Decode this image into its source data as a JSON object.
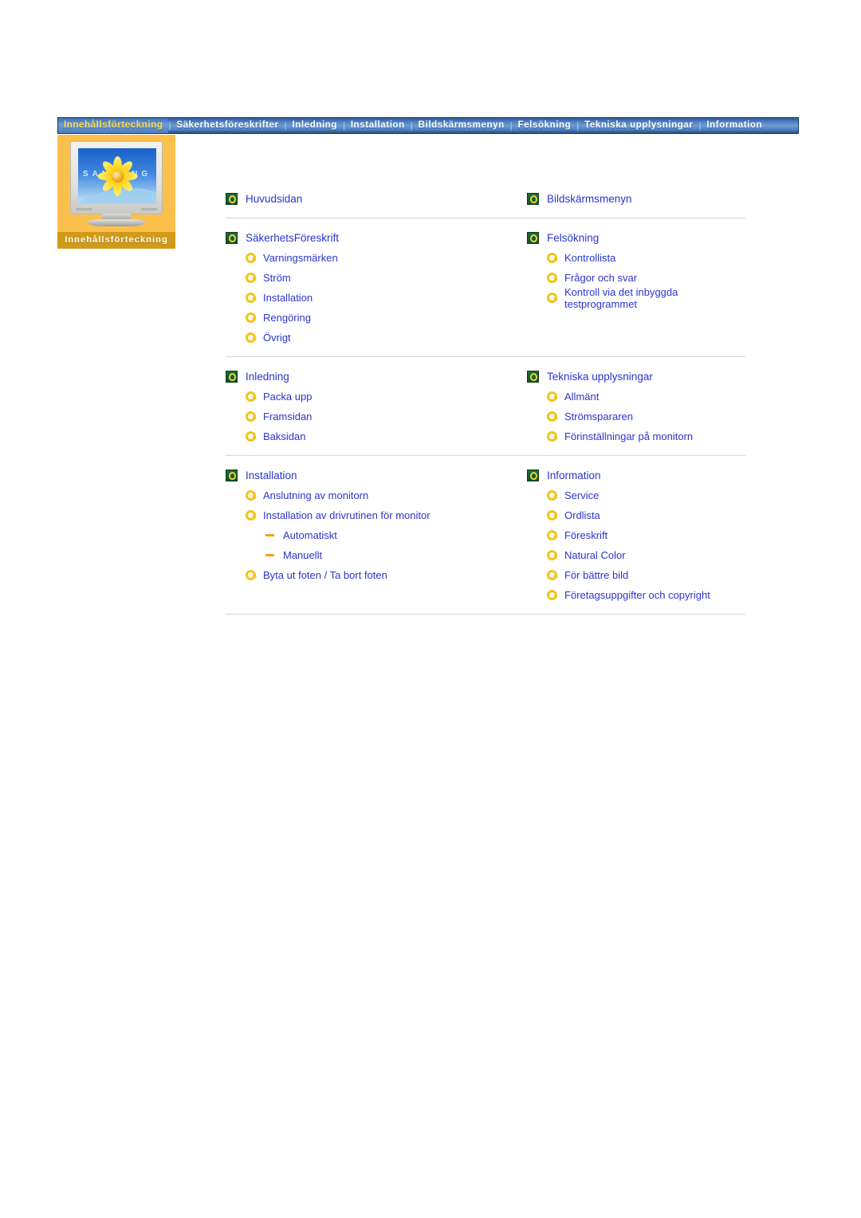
{
  "nav": {
    "items": [
      {
        "label": "Innehållsförteckning",
        "active": true
      },
      {
        "label": "Säkerhetsföreskrifter",
        "active": false
      },
      {
        "label": "Inledning",
        "active": false
      },
      {
        "label": "Installation",
        "active": false
      },
      {
        "label": "Bildskärmsmenyn",
        "active": false
      },
      {
        "label": "Felsökning",
        "active": false
      },
      {
        "label": "Tekniska upplysningar",
        "active": false
      },
      {
        "label": "Information",
        "active": false
      }
    ],
    "separator": "|"
  },
  "banner": {
    "title": "Innehållsförteckning",
    "brand_text": "SAMSUNG",
    "icon": "monitor-thumbnail"
  },
  "colors": {
    "link": "#2b35cf",
    "nav_active_text": "#ffe14d",
    "banner_bg": "#fbc14c",
    "banner_title_bg": "#d19a18",
    "divider": "#d8d8c8",
    "icon_square_green": "#14512a",
    "icon_ring_yellow": "#f2c41e",
    "icon_dash_orange": "#f0a21a"
  },
  "toc": {
    "groups": [
      {
        "left": {
          "title": "Huvudsidan",
          "children": []
        },
        "right": {
          "title": "Bildskärmsmenyn",
          "children": []
        }
      },
      {
        "left": {
          "title": "SäkerhetsFöreskrift",
          "children": [
            {
              "label": "Varningsmärken"
            },
            {
              "label": "Ström"
            },
            {
              "label": "Installation"
            },
            {
              "label": "Rengöring"
            },
            {
              "label": "Övrigt"
            }
          ]
        },
        "right": {
          "title": "Felsökning",
          "children": [
            {
              "label": "Kontrollista"
            },
            {
              "label": "Frågor och svar"
            },
            {
              "label": "Kontroll via det inbyggda testprogrammet"
            }
          ]
        }
      },
      {
        "left": {
          "title": "Inledning",
          "children": [
            {
              "label": "Packa upp"
            },
            {
              "label": "Framsidan"
            },
            {
              "label": "Baksidan"
            }
          ]
        },
        "right": {
          "title": "Tekniska upplysningar",
          "children": [
            {
              "label": "Allmänt"
            },
            {
              "label": "Strömspararen"
            },
            {
              "label": "Förinställningar på monitorn"
            }
          ]
        }
      },
      {
        "left": {
          "title": "Installation",
          "children": [
            {
              "label": "Anslutning av monitorn"
            },
            {
              "label": "Installation av drivrutinen för monitor",
              "sub": [
                {
                  "label": "Automatiskt"
                },
                {
                  "label": "Manuellt"
                }
              ]
            },
            {
              "label": "Byta ut foten / Ta bort foten"
            }
          ]
        },
        "right": {
          "title": "Information",
          "children": [
            {
              "label": "Service"
            },
            {
              "label": "Ordlista"
            },
            {
              "label": "Föreskrift"
            },
            {
              "label": "Natural Color"
            },
            {
              "label": "För bättre bild"
            },
            {
              "label": "Företagsuppgifter och copyright"
            }
          ]
        }
      }
    ]
  }
}
